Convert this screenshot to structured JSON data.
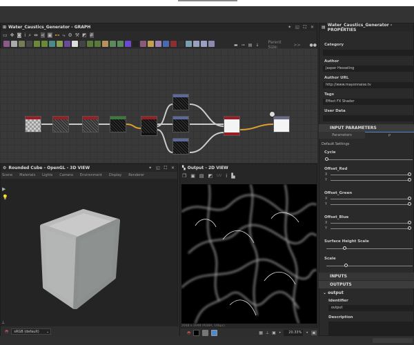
{
  "graph": {
    "title": "Water_Caustics_Generator - GRAPH",
    "parent_size_label": "Parent Size:",
    "parent_size_value": ">>",
    "icon_colors": [
      "#8a5a8a",
      "#aaa",
      "#7a7a5a",
      "#444",
      "#6a8a3a",
      "#6a8a3a",
      "#4a8a8a",
      "#8aa050",
      "#6a4a9a",
      "#ddd",
      "#444",
      "#5a7a3a",
      "#5a7a3a",
      "#b89060",
      "#5a8a5a",
      "#5a8a5a",
      "#6a4ad0",
      "#222",
      "#8a5a7a",
      "#c0a050",
      "#a080b0",
      "#4a6ab0",
      "#8a3030",
      "#333",
      "#7aa0b0",
      "#9aa0c0",
      "#9aa0c0",
      "#8a8ab0"
    ]
  },
  "properties": {
    "title": "Water_Caustics_Generator - PROPERTIES",
    "category_label": "Category",
    "category_value": "",
    "author_label": "Author",
    "author_value": "Jasper Hesseling",
    "author_url_label": "Author URL",
    "author_url_value": "http://www.mayonnaise.tv",
    "tags_label": "Tags",
    "tags_value": "Effect FX Shader",
    "user_data_label": "User Data",
    "input_parameters": "INPUT PARAMETERS",
    "tab_parameters": "Parameters",
    "tab_presets": "P",
    "default_settings": "Default Settings",
    "params": [
      {
        "name": "Cycle",
        "value": 0
      },
      {
        "name": "Offset_Red"
      },
      {
        "name": "Offset_Green"
      },
      {
        "name": "Offset_Blue"
      },
      {
        "name": "Surface Height Scale",
        "value": 0.25
      },
      {
        "name": "Scale",
        "value": 0.27
      }
    ],
    "axis_x": "X",
    "axis_y": "Y",
    "inputs": "INPUTS",
    "outputs": "OUTPUTS",
    "output_name": "output",
    "identifier_label": "Identifier",
    "identifier_value": "output",
    "description_label": "Description"
  },
  "view3d": {
    "title": "Rounded Cube - OpenGL - 3D VIEW",
    "menu": [
      "Scene",
      "Materials",
      "Lights",
      "Camera",
      "Environment",
      "Display",
      "Renderer"
    ],
    "colorspace": "sRGB (default)"
  },
  "view2d": {
    "title": "Output - 2D VIEW",
    "uv_label": "UV",
    "info": "2048 x 2048 (RGBA, 16bpc)",
    "zoom": "20.33%"
  }
}
